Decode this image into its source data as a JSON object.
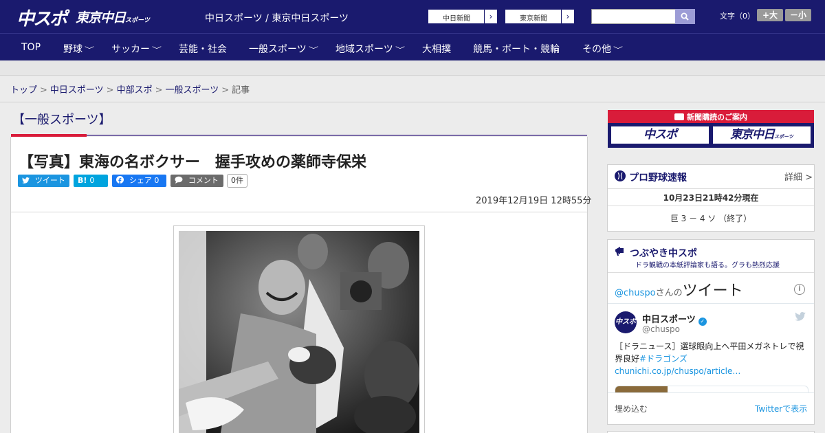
{
  "header": {
    "logo_main": "中スポ",
    "logo_tokyo": "東京中日",
    "logo_tokyo_small": "スポーツ",
    "site_title": "中日スポーツ / 東京中日スポーツ",
    "paper_links": [
      {
        "label": "中日新聞"
      },
      {
        "label": "東京新聞"
      }
    ],
    "search": {
      "value": "",
      "placeholder": ""
    },
    "font_size": {
      "label": "文字（0）",
      "larger": "+大",
      "smaller": "－小"
    }
  },
  "nav": {
    "items": [
      {
        "label": "TOP",
        "has_menu": false
      },
      {
        "label": "野球",
        "has_menu": true
      },
      {
        "label": "サッカー",
        "has_menu": true
      },
      {
        "label": "芸能・社会",
        "has_menu": false
      },
      {
        "label": "一般スポーツ",
        "has_menu": true
      },
      {
        "label": "地域スポーツ",
        "has_menu": true
      },
      {
        "label": "大相撲",
        "has_menu": false
      },
      {
        "label": "競馬・ボート・競輪",
        "has_menu": false
      },
      {
        "label": "その他",
        "has_menu": true
      }
    ],
    "chevron": "﹀"
  },
  "breadcrumb": {
    "items": [
      "トップ",
      "中日スポーツ",
      "中部スポ",
      "一般スポーツ"
    ],
    "current": "記事",
    "separator": ">"
  },
  "section": {
    "title": "【一般スポーツ】"
  },
  "article": {
    "title": "【写真】東海の名ボクサー　握手攻めの薬師寺保栄",
    "share": {
      "tweet": "ツイート",
      "hatena_icon": "B!",
      "hatena_count": "0",
      "facebook": "シェア",
      "facebook_count": "0",
      "comment": "コメント",
      "comment_count": "0件"
    },
    "date": "2019年12月19日 12時55分"
  },
  "sidebar": {
    "subscribe": {
      "heading": "新聞購読のご案内",
      "logo_main": "中スポ",
      "logo_tokyo": "東京中日",
      "logo_tokyo_small": "スポーツ"
    },
    "baseball": {
      "title": "プロ野球速報",
      "detail_link": "詳細 >",
      "as_of": "10月23日21時42分現在",
      "score": "巨 3 － 4 ソ （終了）"
    },
    "tweets": {
      "title": "つぶやき中スポ",
      "subtitle": "ドラ観戦の本紙評論家も語る。グラも熱烈応援",
      "timeline_handle_prefix": "@chuspo",
      "timeline_mid": "さんの",
      "timeline_heading": "ツイート",
      "account_name": "中日スポーツ",
      "account_handle": "@chuspo",
      "avatar_text": "中スポ",
      "tweet_text": "［ドラニュース］選球眼向上へ平田メガネトレで視界良好",
      "tweet_tag": "#ドラゴンズ",
      "tweet_link": "chunichi.co.jp/chuspo/article…",
      "embed_label": "埋め込む",
      "view_label": "Twitterで表示"
    }
  },
  "colors": {
    "brand_navy": "#1a1a6e",
    "accent_red": "#d91c3a",
    "twitter_blue": "#1b95e0",
    "facebook_blue": "#1877f2",
    "hatena_blue": "#00a4de",
    "comment_gray": "#6b6b6b"
  }
}
